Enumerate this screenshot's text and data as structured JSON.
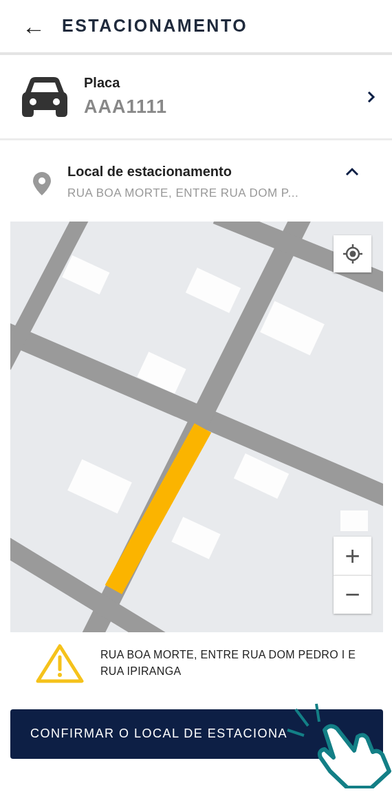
{
  "header": {
    "back": "←",
    "title": "ESTACIONAMENTO"
  },
  "vehicle": {
    "label": "Placa",
    "plate": "AAA1111"
  },
  "location": {
    "label": "Local de estacionamento",
    "address": "RUA BOA MORTE, ENTRE RUA DOM P...",
    "expanded": true
  },
  "map": {
    "kind": "picture",
    "zoom_in": "+",
    "zoom_out": "−"
  },
  "warning": {
    "text": "RUA BOA MORTE, ENTRE RUA DOM PEDRO I E RUA IPIRANGA"
  },
  "confirm_button": {
    "label": "CONFIRMAR O LOCAL DE ESTACIONA"
  }
}
